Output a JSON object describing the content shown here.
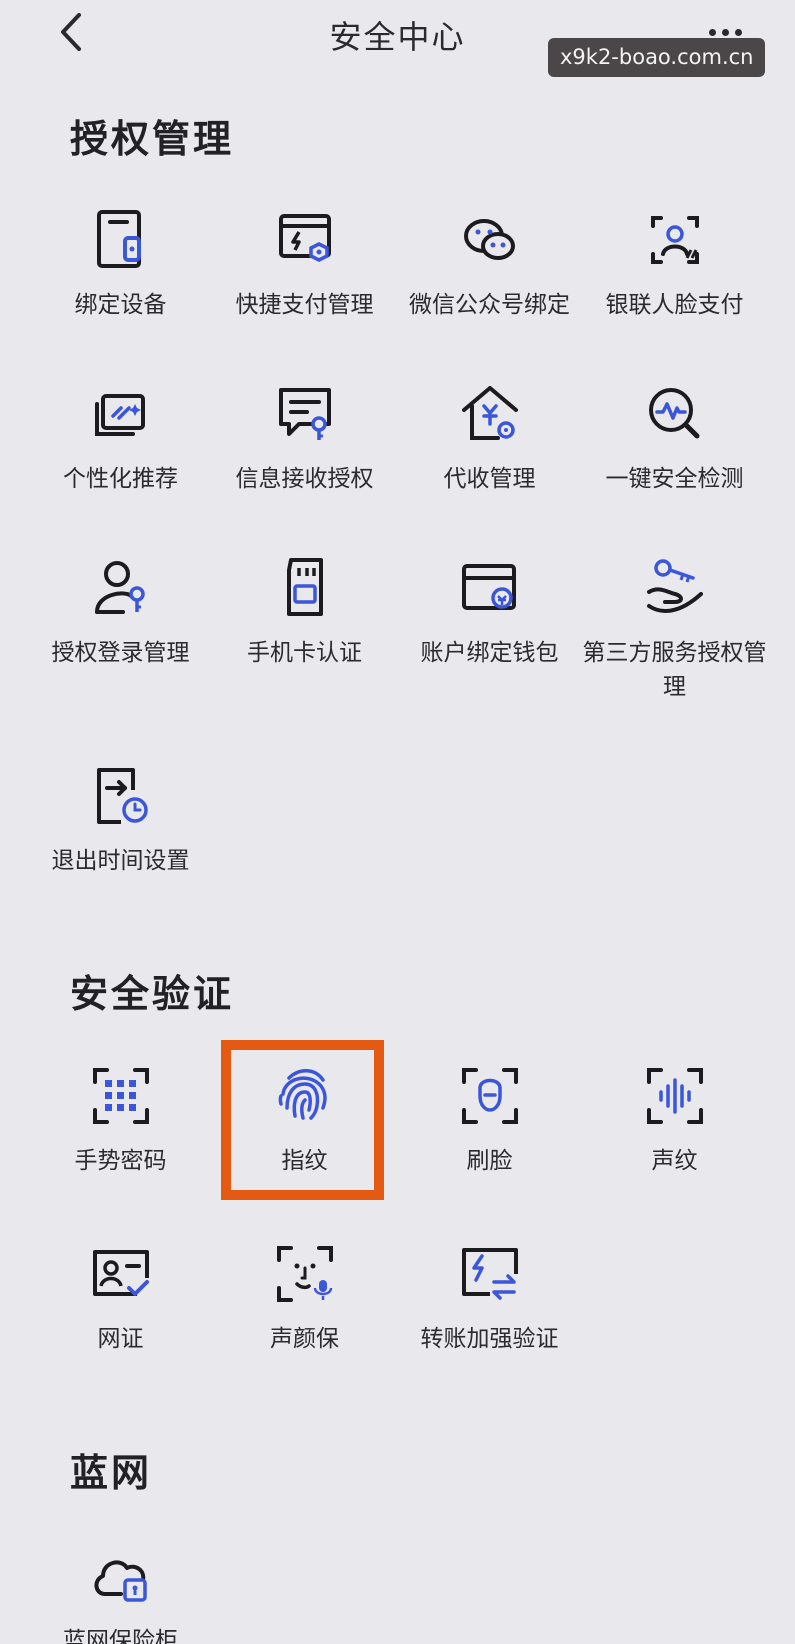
{
  "header": {
    "title": "安全中心",
    "back_icon": "chevron-left-icon",
    "more_icon": "more-dots-icon"
  },
  "watermark": "x9k2-boao.com.cn",
  "accent_color": "#3b56d9",
  "highlight_color": "#e55a12",
  "sections": {
    "authorization": {
      "title": "授权管理",
      "items": [
        {
          "label": "绑定设备",
          "icon": "device-binding-icon"
        },
        {
          "label": "快捷支付管理",
          "icon": "quick-pay-icon"
        },
        {
          "label": "微信公众号绑定",
          "icon": "wechat-icon"
        },
        {
          "label": "银联人脸支付",
          "icon": "face-pay-icon"
        },
        {
          "label": "个性化推荐",
          "icon": "personalized-recommend-icon"
        },
        {
          "label": "信息接收授权",
          "icon": "message-auth-icon"
        },
        {
          "label": "代收管理",
          "icon": "collection-house-icon"
        },
        {
          "label": "一键安全检测",
          "icon": "security-scan-icon"
        },
        {
          "label": "授权登录管理",
          "icon": "login-auth-user-icon"
        },
        {
          "label": "手机卡认证",
          "icon": "sim-card-icon"
        },
        {
          "label": "账户绑定钱包",
          "icon": "wallet-binding-icon"
        },
        {
          "label": "第三方服务授权管理",
          "icon": "third-party-key-icon"
        },
        {
          "label": "退出时间设置",
          "icon": "logout-timer-icon"
        }
      ]
    },
    "verification": {
      "title": "安全验证",
      "items": [
        {
          "label": "手势密码",
          "icon": "gesture-password-icon"
        },
        {
          "label": "指纹",
          "icon": "fingerprint-icon"
        },
        {
          "label": "刷脸",
          "icon": "face-scan-icon"
        },
        {
          "label": "声纹",
          "icon": "voiceprint-icon"
        },
        {
          "label": "网证",
          "icon": "id-card-icon"
        },
        {
          "label": "声颜保",
          "icon": "face-voice-icon"
        },
        {
          "label": "转账加强验证",
          "icon": "transfer-verify-icon"
        }
      ]
    },
    "blue_net": {
      "title": "蓝网",
      "items": [
        {
          "label": "蓝网保险柜",
          "icon": "cloud-safe-icon"
        }
      ]
    }
  }
}
